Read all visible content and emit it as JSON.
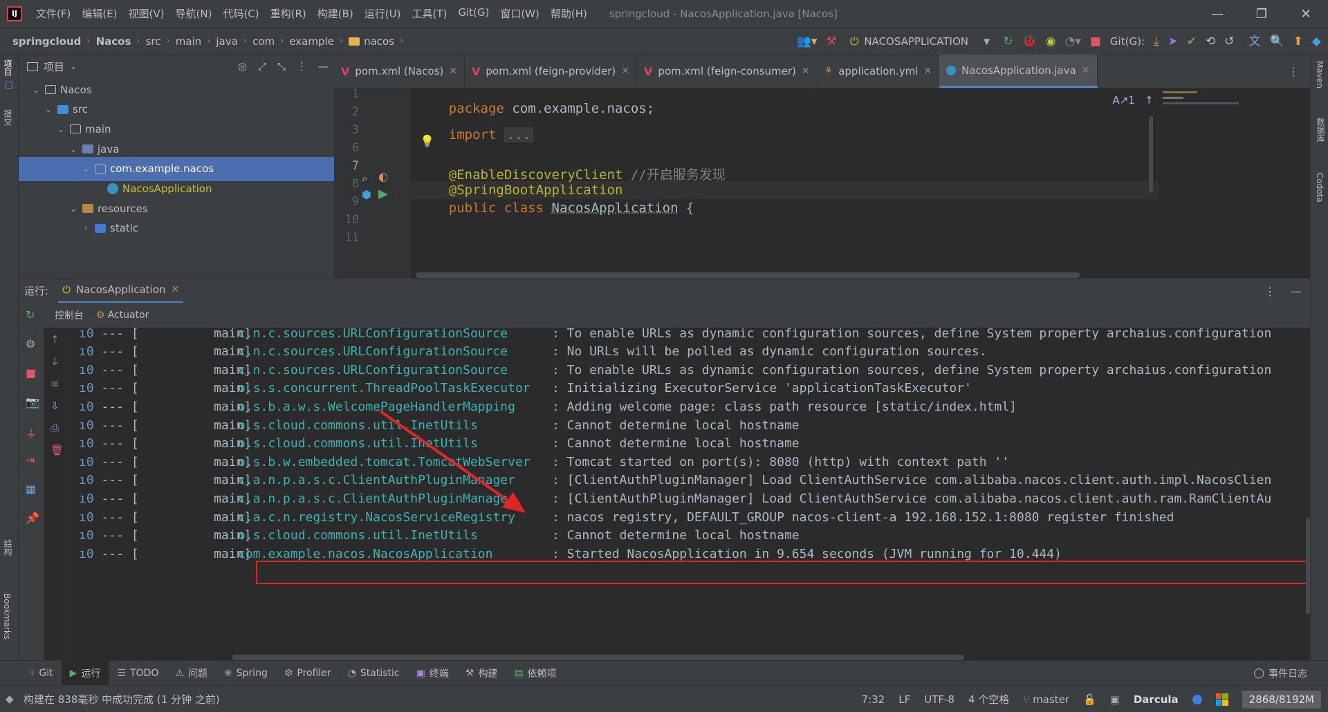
{
  "app": {
    "title": "springcloud - NacosApplication.java [Nacos]",
    "logo_text": "IJ",
    "menu": [
      "文件(F)",
      "编辑(E)",
      "视图(V)",
      "导航(N)",
      "代码(C)",
      "重构(R)",
      "构建(B)",
      "运行(U)",
      "工具(T)",
      "Git(G)",
      "窗口(W)",
      "帮助(H)"
    ]
  },
  "breadcrumbs": [
    "springcloud",
    "Nacos",
    "src",
    "main",
    "java",
    "com",
    "example",
    "nacos"
  ],
  "run_config": {
    "name": "NACOSAPPLICATION",
    "git_label": "Git(G):"
  },
  "left_strip": {
    "project": "项目",
    "commit": "提交",
    "structure": "结构",
    "bookmarks": "Bookmarks"
  },
  "right_strip": {
    "maven": "Maven",
    "database": "数据库",
    "codota": "Codota"
  },
  "project_panel": {
    "title": "项目",
    "tree": [
      {
        "label": "Nacos",
        "depth": 1,
        "expanded": true,
        "kind": "folder"
      },
      {
        "label": "src",
        "depth": 2,
        "expanded": true,
        "kind": "src"
      },
      {
        "label": "main",
        "depth": 3,
        "expanded": true,
        "kind": "folder"
      },
      {
        "label": "java",
        "depth": 4,
        "expanded": true,
        "kind": "java-src"
      },
      {
        "label": "com.example.nacos",
        "depth": 5,
        "expanded": true,
        "kind": "pkg",
        "selected": true
      },
      {
        "label": "NacosApplication",
        "depth": 6,
        "kind": "class"
      },
      {
        "label": "resources",
        "depth": 4,
        "expanded": true,
        "kind": "res"
      },
      {
        "label": "static",
        "depth": 5,
        "expanded": false,
        "kind": "static"
      }
    ]
  },
  "editor_tabs": [
    {
      "label": "pom.xml (Nacos)",
      "kind": "maven"
    },
    {
      "label": "pom.xml (feign-provider)",
      "kind": "maven"
    },
    {
      "label": "pom.xml (feign-consumer)",
      "kind": "maven"
    },
    {
      "label": "application.yml",
      "kind": "yaml"
    },
    {
      "label": "NacosApplication.java",
      "kind": "java",
      "active": true
    }
  ],
  "editor": {
    "line_numbers": [
      "1",
      "2",
      "3",
      "6",
      "7",
      "8",
      "9",
      "10",
      "11"
    ],
    "inspection": "1",
    "lines": {
      "l1_kw": "package",
      "l1_rest": " com.example.nacos;",
      "l3_kw": "import",
      "l3_fold": "...",
      "l7_ann": "@EnableDiscoveryClient",
      "l7_cmt": " //开启服务发现",
      "l8_ann": "@SpringBootApplication",
      "l9_kw": "public class",
      "l9_cls": "NacosApplication",
      "l9_rest": " {"
    }
  },
  "run_panel": {
    "label": "运行:",
    "tab": "NacosApplication",
    "subtabs": [
      "控制台",
      "Actuator"
    ]
  },
  "console": {
    "lines": [
      {
        "prefix": "---",
        "thread": "main]",
        "logger": "c.n.c.sources.URLConfigurationSource",
        "msg": ": To enable URLs as dynamic configuration sources, define System property archaius.configuration"
      },
      {
        "prefix": "---",
        "thread": "main]",
        "logger": "c.n.c.sources.URLConfigurationSource",
        "msg": ": No URLs will be polled as dynamic configuration sources."
      },
      {
        "prefix": "---",
        "thread": "main]",
        "logger": "c.n.c.sources.URLConfigurationSource",
        "msg": ": To enable URLs as dynamic configuration sources, define System property archaius.configuration"
      },
      {
        "prefix": "---",
        "thread": "main]",
        "logger": "o.s.s.concurrent.ThreadPoolTaskExecutor",
        "msg": ": Initializing ExecutorService 'applicationTaskExecutor'"
      },
      {
        "prefix": "---",
        "thread": "main]",
        "logger": "o.s.b.a.w.s.WelcomePageHandlerMapping",
        "msg": ": Adding welcome page: class path resource [static/index.html]"
      },
      {
        "prefix": "---",
        "thread": "main]",
        "logger": "o.s.cloud.commons.util.InetUtils",
        "msg": ": Cannot determine local hostname"
      },
      {
        "prefix": "---",
        "thread": "main]",
        "logger": "o.s.cloud.commons.util.InetUtils",
        "msg": ": Cannot determine local hostname"
      },
      {
        "prefix": "---",
        "thread": "main]",
        "logger": "o.s.b.w.embedded.tomcat.TomcatWebServer",
        "msg": ": Tomcat started on port(s): 8080 (http) with context path ''"
      },
      {
        "prefix": "---",
        "thread": "main]",
        "logger": "c.a.n.p.a.s.c.ClientAuthPluginManager",
        "msg": ": [ClientAuthPluginManager] Load ClientAuthService com.alibaba.nacos.client.auth.impl.NacosClien"
      },
      {
        "prefix": "---",
        "thread": "main]",
        "logger": "c.a.n.p.a.s.c.ClientAuthPluginManager",
        "msg": ": [ClientAuthPluginManager] Load ClientAuthService com.alibaba.nacos.client.auth.ram.RamClientAu"
      },
      {
        "prefix": "---",
        "thread": "main]",
        "logger": "c.a.c.n.registry.NacosServiceRegistry",
        "msg": ": nacos registry, DEFAULT_GROUP nacos-client-a 192.168.152.1:8080 register finished",
        "highlighted": true
      },
      {
        "prefix": "---",
        "thread": "main]",
        "logger": "o.s.cloud.commons.util.InetUtils",
        "msg": ": Cannot determine local hostname"
      },
      {
        "prefix": "---",
        "thread": "main]",
        "logger": "com.example.nacos.NacosApplication",
        "msg": ": Started NacosApplication in 9.654 seconds (JVM running for 10.444)"
      }
    ]
  },
  "bottom_tabs": [
    {
      "label": "Git",
      "icon": "git-icon"
    },
    {
      "label": "运行",
      "icon": "run-icon",
      "active": true
    },
    {
      "label": "TODO",
      "icon": "todo-icon"
    },
    {
      "label": "问题",
      "icon": "problems-icon"
    },
    {
      "label": "Spring",
      "icon": "spring-icon"
    },
    {
      "label": "Profiler",
      "icon": "profiler-icon"
    },
    {
      "label": "Statistic",
      "icon": "statistic-icon"
    },
    {
      "label": "终端",
      "icon": "terminal-icon"
    },
    {
      "label": "构建",
      "icon": "build-icon"
    },
    {
      "label": "依赖项",
      "icon": "dependencies-icon"
    }
  ],
  "events_tab": "事件日志",
  "status": {
    "message": "构建在 838毫秒 中成功完成 (1 分钟 之前)",
    "position": "7:32",
    "line_sep": "LF",
    "encoding": "UTF-8",
    "indent": "4 个空格",
    "branch": "master",
    "theme": "Darcula",
    "memory": "2868/8192M"
  },
  "colors": {
    "accent": "#4a88c7",
    "selection": "#4b6eaf",
    "highlight_box": "#e32424"
  }
}
